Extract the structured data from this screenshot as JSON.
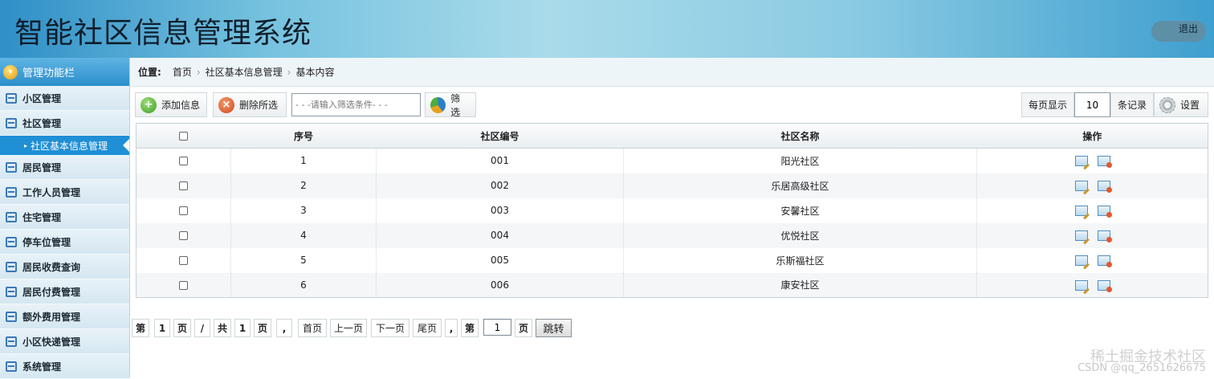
{
  "header": {
    "title": "智能社区信息管理系统",
    "logout_label": "退出"
  },
  "sidebar": {
    "title": "管理功能栏",
    "items": [
      {
        "label": "小区管理"
      },
      {
        "label": "社区管理",
        "sub": [
          "社区基本信息管理"
        ]
      },
      {
        "label": "居民管理"
      },
      {
        "label": "工作人员管理"
      },
      {
        "label": "住宅管理"
      },
      {
        "label": "停车位管理"
      },
      {
        "label": "居民收费查询"
      },
      {
        "label": "居民付费管理"
      },
      {
        "label": "额外费用管理"
      },
      {
        "label": "小区快递管理"
      },
      {
        "label": "系统管理"
      }
    ]
  },
  "breadcrumb": {
    "label": "位置:",
    "items": [
      "首页",
      "社区基本信息管理",
      "基本内容"
    ]
  },
  "toolbar": {
    "add_label": "添加信息",
    "delete_label": "删除所选",
    "filter_placeholder": "- - -请输入筛选条件- - -",
    "filter_label": "筛选",
    "per_page_label": "每页显示",
    "per_page_value": "10",
    "records_label": "条记录",
    "settings_label": "设置"
  },
  "table": {
    "headers": [
      "",
      "序号",
      "社区编号",
      "社区名称",
      "操作"
    ],
    "rows": [
      {
        "no": "1",
        "code": "001",
        "name": "阳光社区"
      },
      {
        "no": "2",
        "code": "002",
        "name": "乐居高级社区"
      },
      {
        "no": "3",
        "code": "003",
        "name": "安馨社区"
      },
      {
        "no": "4",
        "code": "004",
        "name": "优悦社区"
      },
      {
        "no": "5",
        "code": "005",
        "name": "乐斯福社区"
      },
      {
        "no": "6",
        "code": "006",
        "name": "康安社区"
      }
    ]
  },
  "pager": {
    "di": "第",
    "page": "1",
    "ye": "页",
    "slash": "/",
    "gong": "共",
    "total": "1",
    "ye2": "页",
    "comma": ",",
    "first": "首页",
    "prev": "上一页",
    "next": "下一页",
    "last": "尾页",
    "comma2": ",",
    "di2": "第",
    "input_value": "1",
    "ye3": "页",
    "jump": "跳转"
  },
  "watermark": {
    "line1": "稀土掘金技术社区",
    "line2": "CSDN @qq_2651626675"
  }
}
